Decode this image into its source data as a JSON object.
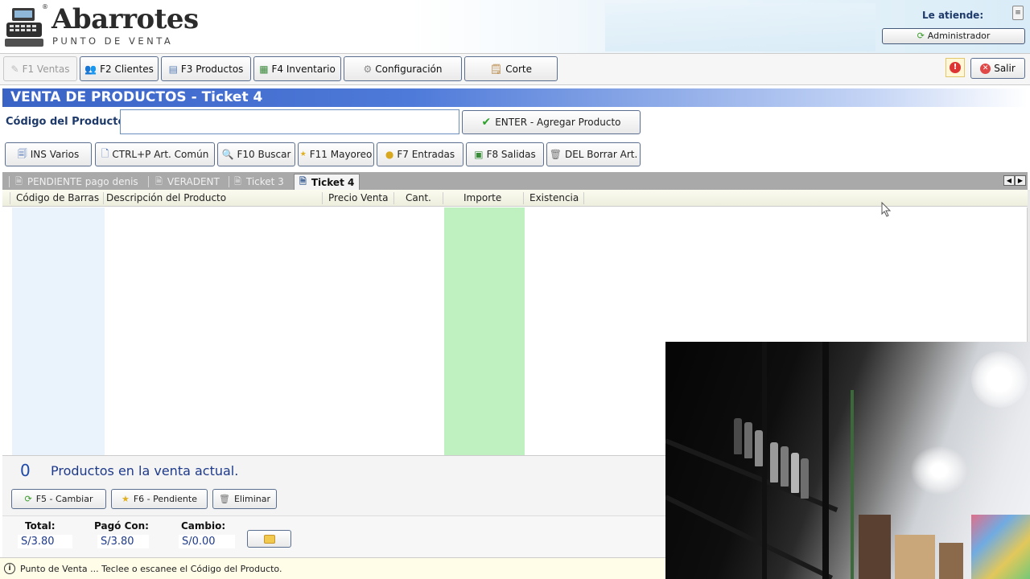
{
  "app": {
    "logo_title": "Abarrotes",
    "logo_subtitle": "PUNTO DE VENTA",
    "logo_reg": "®",
    "attends_label": "Le atiende:",
    "user_button": "Administrador",
    "minimize_glyph": "≡"
  },
  "nav": {
    "ventas": "F1 Ventas",
    "clientes": "F2 Clientes",
    "productos": "F3 Productos",
    "inventario": "F4 Inventario",
    "configuracion": "Configuración",
    "corte": "Corte",
    "alert_glyph": "!",
    "salir": "Salir"
  },
  "sale": {
    "title": "VENTA DE PRODUCTOS - Ticket 4",
    "code_label": "Código del Producto:",
    "code_value": "",
    "enter_button": "ENTER - Agregar Producto"
  },
  "toolbar": {
    "varios": "INS Varios",
    "comun": "CTRL+P Art. Común",
    "buscar": "F10 Buscar",
    "mayoreo": "F11 Mayoreo",
    "entradas": "F7 Entradas",
    "salidas": "F8 Salidas",
    "borrar": "DEL Borrar Art."
  },
  "tickets": {
    "tabs": [
      {
        "label": "PENDIENTE pago denis",
        "active": false
      },
      {
        "label": "VERADENT",
        "active": false
      },
      {
        "label": "Ticket 3",
        "active": false
      },
      {
        "label": "Ticket 4",
        "active": true
      }
    ]
  },
  "table": {
    "columns": [
      "Código de Barras",
      "Descripción del Producto",
      "Precio Venta",
      "Cant.",
      "Importe",
      "Existencia"
    ],
    "rows": []
  },
  "summary": {
    "count": "0",
    "count_label": "Productos en la venta actual.",
    "cambiar": "F5 - Cambiar",
    "pendiente": "F6 - Pendiente",
    "eliminar": "Eliminar"
  },
  "totals": {
    "total_label": "Total:",
    "total_value": "S/3.80",
    "pago_label": "Pagó Con:",
    "pago_value": "S/3.80",
    "cambio_label": "Cambio:",
    "cambio_value": "S/0.00"
  },
  "status": {
    "message": "Punto de Venta ... Teclee o escanee el Código del Producto.",
    "info_glyph": "i"
  },
  "colors": {
    "title_band": "#3a63c6",
    "importe_column": "#bff0bf",
    "barcode_column": "#eaf3fc",
    "link_blue": "#1e3a8a"
  }
}
